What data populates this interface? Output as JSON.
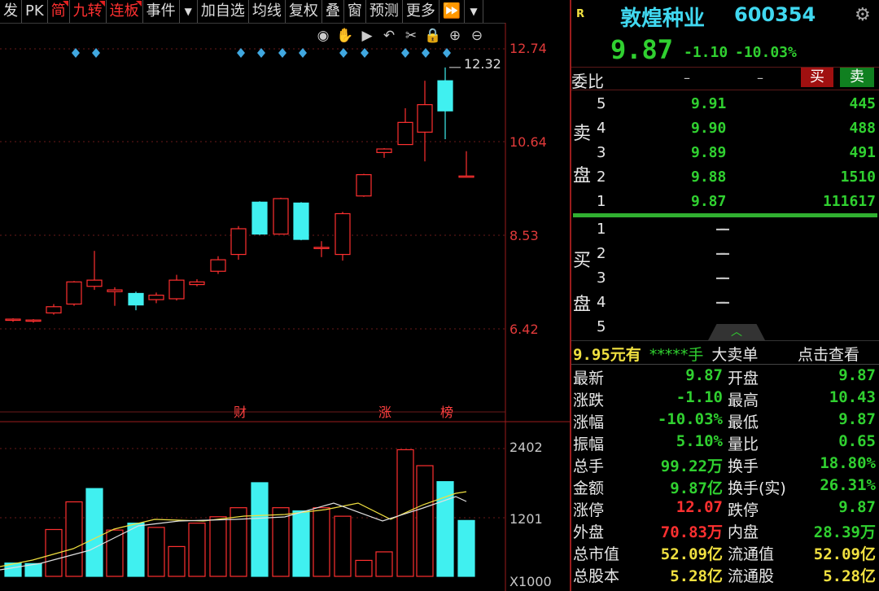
{
  "toolbar": {
    "items": [
      "发",
      "PK",
      "简",
      "九转",
      "连板",
      "事件",
      "▼",
      "加自选",
      "均线",
      "复权",
      "叠",
      "窗",
      "预测",
      "更多",
      "⏩",
      "▼"
    ]
  },
  "chart_icons": [
    "eye-icon",
    "hand-icon",
    "play-icon",
    "undo-icon",
    "scissors-icon",
    "lock-icon",
    "zoom-in-icon",
    "zoom-out-icon"
  ],
  "price_axis": {
    "labels": [
      "12.74",
      "10.64",
      "8.53",
      "6.42"
    ],
    "high_marker": "12.32"
  },
  "event_markers": [
    "财",
    "涨",
    "榜"
  ],
  "volume_axis": {
    "labels": [
      "2402",
      "1201"
    ],
    "unit": "X1000"
  },
  "stock": {
    "badge": "R",
    "name": "敦煌种业",
    "code": "600354",
    "price": "9.87",
    "change": "-1.10",
    "change_pct": "-10.03%"
  },
  "order_book": {
    "weibi_label": "委比",
    "weibi_values": [
      "–",
      "–"
    ],
    "buy_btn": "买",
    "sell_btn": "卖",
    "sell_label": [
      "卖",
      "盘"
    ],
    "buy_label": [
      "买",
      "盘"
    ],
    "sell": [
      {
        "level": "5",
        "price": "9.91",
        "vol": "445"
      },
      {
        "level": "4",
        "price": "9.90",
        "vol": "488"
      },
      {
        "level": "3",
        "price": "9.89",
        "vol": "491"
      },
      {
        "level": "2",
        "price": "9.88",
        "vol": "1510"
      },
      {
        "level": "1",
        "price": "9.87",
        "vol": "111617"
      }
    ],
    "buy": [
      {
        "level": "1",
        "price": "–",
        "vol": "–"
      },
      {
        "level": "2",
        "price": "–",
        "vol": "–"
      },
      {
        "level": "3",
        "price": "–",
        "vol": "–"
      },
      {
        "level": "4",
        "price": "–",
        "vol": "–"
      },
      {
        "level": "5",
        "price": "–",
        "vol": "–"
      }
    ]
  },
  "big_order": {
    "price": "9.95元有",
    "stars": "*****手",
    "label": "大卖单",
    "link": "点击查看"
  },
  "quote": [
    {
      "l1": "最新",
      "v1": "9.87",
      "c1": "green",
      "l2": "开盘",
      "v2": "9.87",
      "c2": "green"
    },
    {
      "l1": "涨跌",
      "v1": "-1.10",
      "c1": "green",
      "l2": "最高",
      "v2": "10.43",
      "c2": "green"
    },
    {
      "l1": "涨幅",
      "v1": "-10.03%",
      "c1": "green",
      "l2": "最低",
      "v2": "9.87",
      "c2": "green"
    },
    {
      "l1": "振幅",
      "v1": "5.10%",
      "c1": "green",
      "l2": "量比",
      "v2": "0.65",
      "c2": "green"
    },
    {
      "l1": "总手",
      "v1": "99.22万",
      "c1": "green",
      "l2": "换手",
      "v2": "18.80%",
      "c2": "green"
    },
    {
      "l1": "金额",
      "v1": "9.87亿",
      "c1": "green",
      "l2": "换手(实)",
      "v2": "26.31%",
      "c2": "green"
    },
    {
      "l1": "涨停",
      "v1": "12.07",
      "c1": "red",
      "l2": "跌停",
      "v2": "9.87",
      "c2": "green"
    },
    {
      "l1": "外盘",
      "v1": "70.83万",
      "c1": "red",
      "l2": "内盘",
      "v2": "28.39万",
      "c2": "green"
    },
    {
      "l1": "总市值",
      "v1": "52.09亿",
      "c1": "yellow",
      "l2": "流通值",
      "v2": "52.09亿",
      "c2": "yellow"
    },
    {
      "l1": "总股本",
      "v1": "5.28亿",
      "c1": "yellow",
      "l2": "流通股",
      "v2": "5.28亿",
      "c2": "yellow"
    }
  ],
  "colors": {
    "up": "#ff3030",
    "down": "#40f0f0",
    "bg": "#000000",
    "grid": "#6a1a1a"
  }
}
